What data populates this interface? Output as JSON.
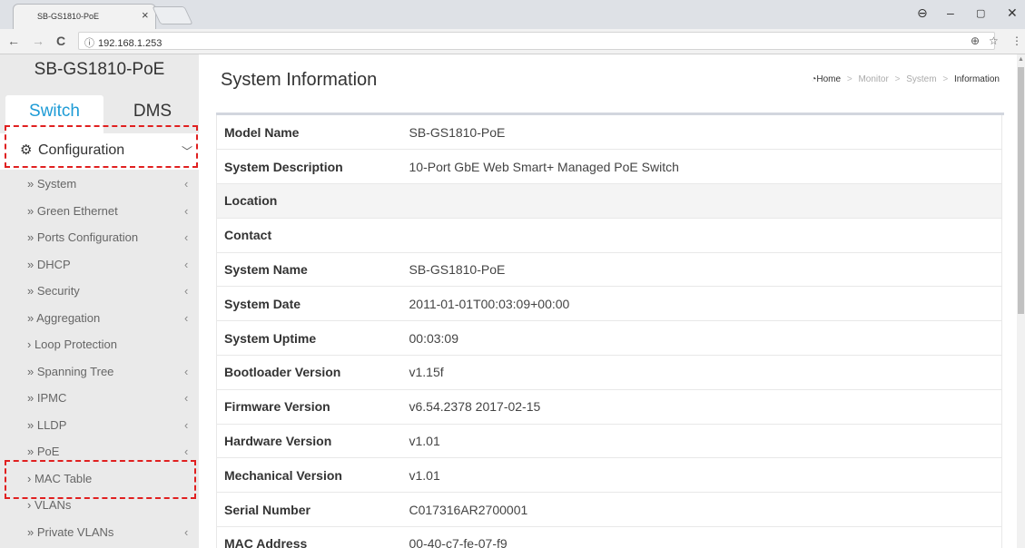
{
  "browser": {
    "tab_title": "SB-GS1810-PoE",
    "tab_close": "×",
    "url": "192.168.1.253",
    "window_buttons": {
      "account": "⊖",
      "minimize": "–",
      "maximize": "▢",
      "close": "✕"
    },
    "nav": {
      "back": "←",
      "forward": "→",
      "reload": "C"
    },
    "info_icon": "ⓘ",
    "zoom_icon": "⊕",
    "star_icon": "☆",
    "menu_icon": "⋮"
  },
  "sidebar": {
    "brand": "SB-GS1810-PoE",
    "tabs": {
      "switch": "Switch",
      "dms": "DMS"
    },
    "config": {
      "label": "Configuration",
      "chevron": "﹀"
    },
    "items": [
      {
        "label": "» System",
        "arrow": "‹"
      },
      {
        "label": "» Green Ethernet",
        "arrow": "‹"
      },
      {
        "label": "» Ports Configuration",
        "arrow": "‹"
      },
      {
        "label": "» DHCP",
        "arrow": "‹"
      },
      {
        "label": "» Security",
        "arrow": "‹"
      },
      {
        "label": "» Aggregation",
        "arrow": "‹"
      },
      {
        "label": "› Loop Protection",
        "arrow": ""
      },
      {
        "label": "» Spanning Tree",
        "arrow": "‹"
      },
      {
        "label": "» IPMC",
        "arrow": "‹"
      },
      {
        "label": "» LLDP",
        "arrow": "‹"
      },
      {
        "label": "» PoE",
        "arrow": "‹"
      },
      {
        "label": "› MAC Table",
        "arrow": ""
      },
      {
        "label": "› VLANs",
        "arrow": ""
      },
      {
        "label": "» Private VLANs",
        "arrow": "‹"
      }
    ]
  },
  "main": {
    "title": "System Information",
    "breadcrumb": {
      "home": "Home",
      "monitor": "Monitor",
      "system": "System",
      "current": "Information",
      "sep": ">"
    },
    "rows": [
      {
        "key": "Model Name",
        "value": "SB-GS1810-PoE"
      },
      {
        "key": "System Description",
        "value": "10-Port GbE Web Smart+ Managed PoE Switch"
      },
      {
        "key": "Location",
        "value": ""
      },
      {
        "key": "Contact",
        "value": ""
      },
      {
        "key": "System Name",
        "value": "SB-GS1810-PoE"
      },
      {
        "key": "System Date",
        "value": "2011-01-01T00:03:09+00:00"
      },
      {
        "key": "System Uptime",
        "value": "00:03:09"
      },
      {
        "key": "Bootloader Version",
        "value": "v1.15f"
      },
      {
        "key": "Firmware Version",
        "value": "v6.54.2378 2017-02-15"
      },
      {
        "key": "Hardware Version",
        "value": "v1.01"
      },
      {
        "key": "Mechanical Version",
        "value": "v1.01"
      },
      {
        "key": "Serial Number",
        "value": "C017316AR2700001"
      },
      {
        "key": "MAC Address",
        "value": "00-40-c7-fe-07-f9"
      }
    ]
  }
}
